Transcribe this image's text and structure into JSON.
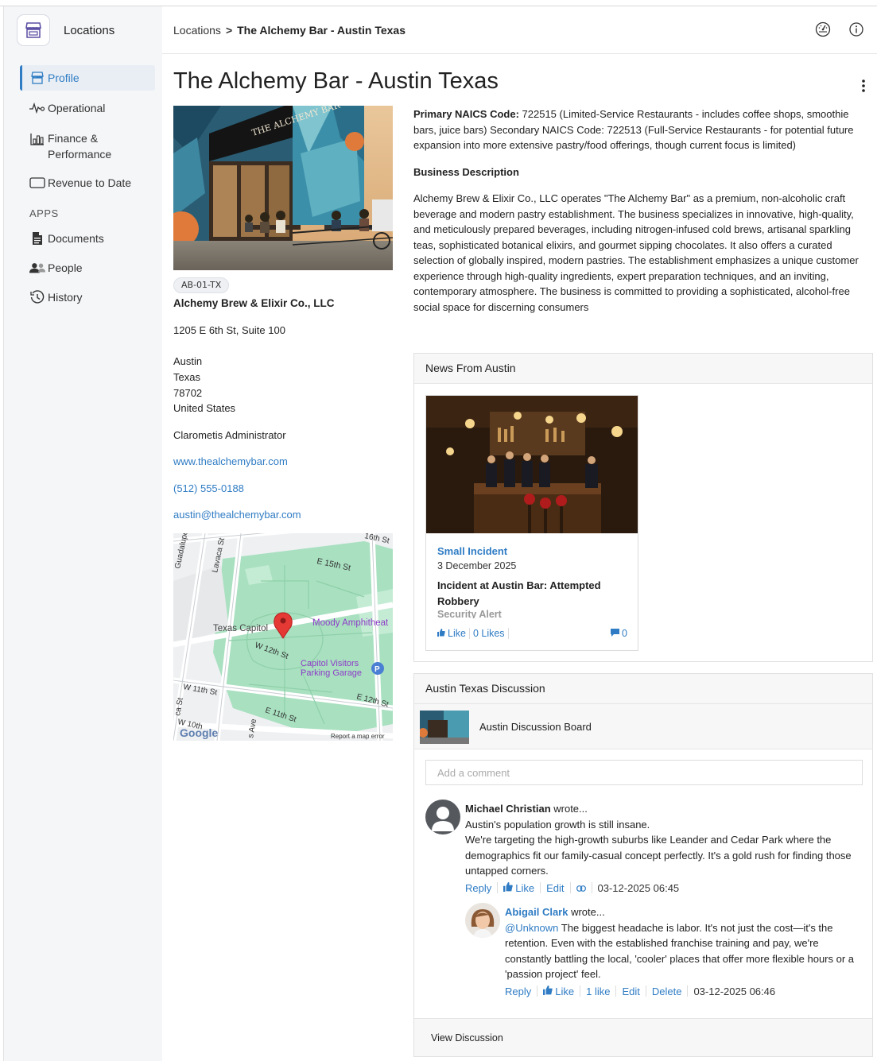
{
  "app": {
    "title": "Locations"
  },
  "breadcrumb": {
    "root": "Locations",
    "separator": ">",
    "current": "The Alchemy Bar - Austin Texas"
  },
  "topbar_icons": [
    "dashboard-gauge-icon",
    "info-icon"
  ],
  "sidebar": {
    "items": [
      {
        "label": "Profile",
        "icon": "storefront-icon",
        "active": true
      },
      {
        "label": "Operational",
        "icon": "pulse-icon"
      },
      {
        "label": "Finance & Performance",
        "icon": "bar-chart-icon"
      },
      {
        "label": "Revenue to Date",
        "icon": "rectangle-icon"
      }
    ],
    "apps_label": "APPS",
    "apps": [
      {
        "label": "Documents",
        "icon": "document-icon"
      },
      {
        "label": "People",
        "icon": "people-icon"
      },
      {
        "label": "History",
        "icon": "history-icon"
      }
    ]
  },
  "location": {
    "title": "The Alchemy Bar - Austin Texas",
    "code": "AB-01-TX",
    "company": "Alchemy Brew & Elixir Co., LLC",
    "address_line1": "1205 E 6th St, Suite 100",
    "city": "Austin",
    "state": "Texas",
    "zip": "78702",
    "country": "United States",
    "admin": "Clarometis Administrator",
    "website": "www.thealchemybar.com",
    "phone": "(512) 555-0188",
    "email": "austin@thealchemybar.com",
    "photo_sign": "THE ALCHEMY BAR"
  },
  "map": {
    "labels": {
      "guadalupe": "Guadalupe",
      "lavaca": "Lavaca St",
      "e15th": "E 15th St",
      "st16": "16th St",
      "capitol": "Texas Capitol",
      "moody": "Moody Amphitheat",
      "w12th": "W 12th St",
      "visitors": "Capitol Visitors",
      "garage": "Parking Garage",
      "w11th": "W 11th St",
      "e12th": "E 12th St",
      "e11th": "E 11th St",
      "w10th": "W 10th",
      "ave": "s Ave",
      "cast": "ca St",
      "google": "Google",
      "report": "Report a map error",
      "p": "P"
    }
  },
  "description": {
    "naics_label": "Primary NAICS Code:",
    "naics_text": " 722515 (Limited-Service Restaurants - includes coffee shops, smoothie bars, juice bars) Secondary NAICS Code: 722513 (Full-Service Restaurants - for potential future expansion into more extensive pastry/food offerings, though current focus is limited)",
    "heading": "Business Description",
    "body": "Alchemy Brew & Elixir Co., LLC operates \"The Alchemy Bar\" as a premium, non-alcoholic craft beverage and modern pastry establishment. The business specializes in innovative, high-quality, and meticulously prepared beverages, including nitrogen-infused cold brews, artisanal sparkling teas, sophisticated botanical elixirs, and gourmet sipping chocolates. It also offers a curated selection of globally inspired, modern pastries. The establishment emphasizes a unique customer experience through high-quality ingredients, expert preparation techniques, and an inviting, contemporary atmosphere. The business is committed to providing a sophisticated, alcohol-free social space for discerning consumers"
  },
  "news": {
    "heading": "News From Austin",
    "item": {
      "category": "Small Incident",
      "date": "3 December 2025",
      "title": "Incident at Austin Bar: Attempted Robbery",
      "subtitle": "Security Alert",
      "like_label": "Like",
      "likes": "0 Likes",
      "comments": "0"
    }
  },
  "discussion": {
    "heading": "Austin Texas Discussion",
    "board": "Austin Discussion Board",
    "input_placeholder": "Add a comment",
    "footer": "View Discussion",
    "comments": [
      {
        "author": "Michael Christian",
        "wrote": " wrote...",
        "lines": [
          "Austin's population growth is still insane.",
          "We're targeting the high-growth suburbs like Leander and Cedar Park where the demographics fit our family-casual concept perfectly. It's a gold rush for finding those untapped corners."
        ],
        "actions": {
          "reply": "Reply",
          "like": "Like",
          "edit": "Edit",
          "date": "03-12-2025 06:45"
        }
      },
      {
        "author": "Abigail Clark",
        "wrote": " wrote...",
        "mention": "@Unknown",
        "text": " The biggest headache is labor. It's not just the cost—it's the retention. Even with the established franchise training and pay, we're constantly battling the local, 'cooler' places that offer more flexible hours or a 'passion project' feel.",
        "actions": {
          "reply": "Reply",
          "like": "Like",
          "likes": "1 like",
          "edit": "Edit",
          "delete": "Delete",
          "date": "03-12-2025 06:46"
        }
      }
    ]
  },
  "colors": {
    "accent": "#2f7cc4",
    "map_park": "#a8e0c0",
    "marker": "#e53935"
  }
}
